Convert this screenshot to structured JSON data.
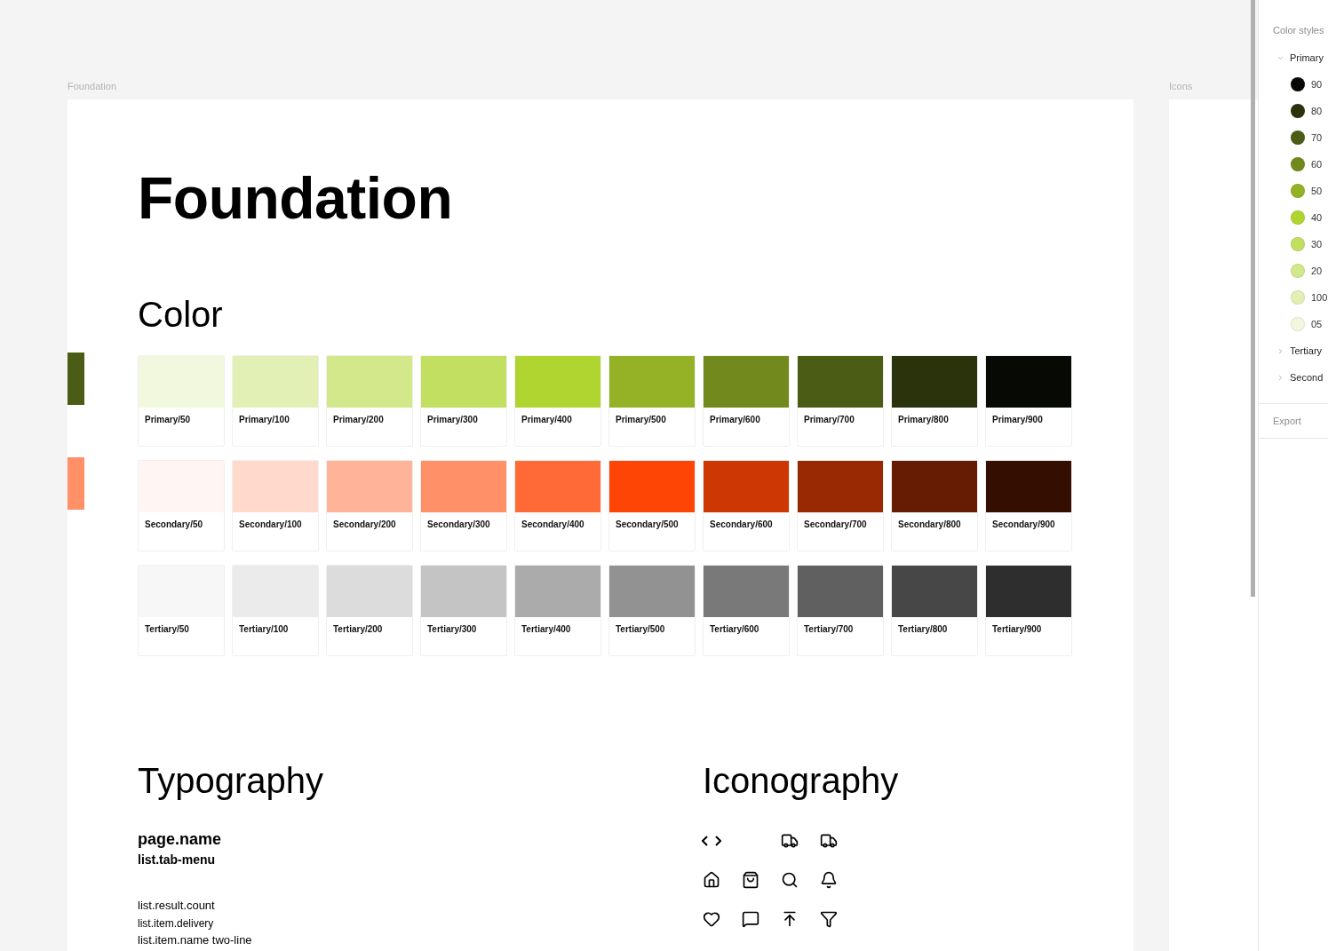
{
  "canvas": {
    "frames": [
      {
        "label": "Foundation",
        "title": "Foundation",
        "color": {
          "heading": "Color",
          "fragments": [
            {
              "color": "#4b5c14"
            },
            {
              "color": "#ff9068"
            }
          ],
          "palettes": [
            {
              "swatches": [
                {
                  "name": "Primary/50",
                  "color": "#f2f8dd"
                },
                {
                  "name": "Primary/100",
                  "color": "#e2f0b5"
                },
                {
                  "name": "Primary/200",
                  "color": "#d3e78b"
                },
                {
                  "name": "Primary/300",
                  "color": "#c2df62"
                },
                {
                  "name": "Primary/400",
                  "color": "#b0d530"
                },
                {
                  "name": "Primary/500",
                  "color": "#95b125"
                },
                {
                  "name": "Primary/600",
                  "color": "#72891d"
                },
                {
                  "name": "Primary/700",
                  "color": "#4b5c14"
                },
                {
                  "name": "Primary/800",
                  "color": "#2b330d"
                },
                {
                  "name": "Primary/900",
                  "color": "#070a04"
                }
              ]
            },
            {
              "swatches": [
                {
                  "name": "Secondary/50",
                  "color": "#fff5f2"
                },
                {
                  "name": "Secondary/100",
                  "color": "#ffd9cc"
                },
                {
                  "name": "Secondary/200",
                  "color": "#ffb49a"
                },
                {
                  "name": "Secondary/300",
                  "color": "#ff9068"
                },
                {
                  "name": "Secondary/400",
                  "color": "#ff6a36"
                },
                {
                  "name": "Secondary/500",
                  "color": "#ff4505"
                },
                {
                  "name": "Secondary/600",
                  "color": "#cc3704"
                },
                {
                  "name": "Secondary/700",
                  "color": "#992903"
                },
                {
                  "name": "Secondary/800",
                  "color": "#661c02"
                },
                {
                  "name": "Secondary/900",
                  "color": "#330e01"
                }
              ]
            },
            {
              "swatches": [
                {
                  "name": "Tertiary/50",
                  "color": "#f7f7f7"
                },
                {
                  "name": "Tertiary/100",
                  "color": "#ebebeb"
                },
                {
                  "name": "Tertiary/200",
                  "color": "#dcdcdc"
                },
                {
                  "name": "Tertiary/300",
                  "color": "#c4c4c4"
                },
                {
                  "name": "Tertiary/400",
                  "color": "#ababab"
                },
                {
                  "name": "Tertiary/500",
                  "color": "#929292"
                },
                {
                  "name": "Tertiary/600",
                  "color": "#797979"
                },
                {
                  "name": "Tertiary/700",
                  "color": "#606060"
                },
                {
                  "name": "Tertiary/800",
                  "color": "#474747"
                },
                {
                  "name": "Tertiary/900",
                  "color": "#2e2e2e"
                }
              ]
            }
          ]
        },
        "typography": {
          "heading": "Typography",
          "styles": [
            {
              "text": "page.name",
              "kind": "title"
            },
            {
              "text": "list.tab-menu",
              "kind": "subtitle"
            },
            {
              "text": "list.result.count",
              "kind": "body"
            },
            {
              "text": "list.item.delivery",
              "kind": "caption"
            },
            {
              "text": "list.item.name two-line",
              "kind": "body"
            }
          ]
        },
        "iconography": {
          "heading": "Iconography"
        }
      },
      {
        "label": "Icons"
      }
    ]
  },
  "panel": {
    "section": "Color styles",
    "groups": [
      {
        "name": "Primary",
        "expanded": true,
        "styles": [
          {
            "name": "90",
            "color": "#070a04"
          },
          {
            "name": "80",
            "color": "#2b330d"
          },
          {
            "name": "70",
            "color": "#4b5c14"
          },
          {
            "name": "60",
            "color": "#72891d"
          },
          {
            "name": "50",
            "color": "#95b125"
          },
          {
            "name": "40",
            "color": "#b0d530"
          },
          {
            "name": "30",
            "color": "#c2df62"
          },
          {
            "name": "20",
            "color": "#d3e78b"
          },
          {
            "name": "100",
            "color": "#e2f0b5"
          },
          {
            "name": "05",
            "color": "#f2f8dd"
          }
        ]
      },
      {
        "name": "Tertiary",
        "expanded": false
      },
      {
        "name": "Second",
        "expanded": false
      }
    ],
    "export": "Export"
  }
}
